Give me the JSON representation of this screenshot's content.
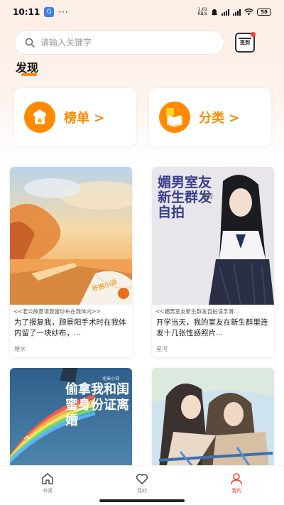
{
  "status_bar": {
    "time": "10:11",
    "app_badge": "G",
    "dots": "···",
    "net_speed_top": "1.61",
    "net_speed_bottom": "KB/s",
    "battery": "58"
  },
  "search": {
    "placeholder": "请输入关键字"
  },
  "signin": {
    "label": "签到"
  },
  "section": {
    "title": "发现"
  },
  "categories": [
    {
      "label": "榜单 >",
      "icon": "ranking-icon"
    },
    {
      "label": "分类 >",
      "icon": "category-icon"
    }
  ],
  "books": [
    {
      "cover_title": "怀抱小说",
      "subtitle": "<<老公故意请我留纱布在我体内>>",
      "description": "为了报复我，顾景阳手术时在我体内留了一块纱布，...",
      "author": "塘水"
    },
    {
      "cover_title": "媚男室友新生群发自拍",
      "cover_badge": "星河",
      "subtitle": "<<媚男室友新生群发自拍误手滑...",
      "description": "开学当天，我的室友在新生群里连发十几张性感照片...",
      "author": "星河"
    },
    {
      "cover_title": "偷拿我和闺蜜身份证离婚",
      "cover_small": "北米小说"
    },
    {
      "cover_title": ""
    }
  ],
  "nav": [
    {
      "label": "书城",
      "icon": "home-icon"
    },
    {
      "label": "我的",
      "icon": "heart-icon"
    },
    {
      "label": "我的",
      "icon": "person-icon"
    }
  ],
  "colors": {
    "accent": "#ff8a00",
    "active_nav": "#ff3b30"
  }
}
